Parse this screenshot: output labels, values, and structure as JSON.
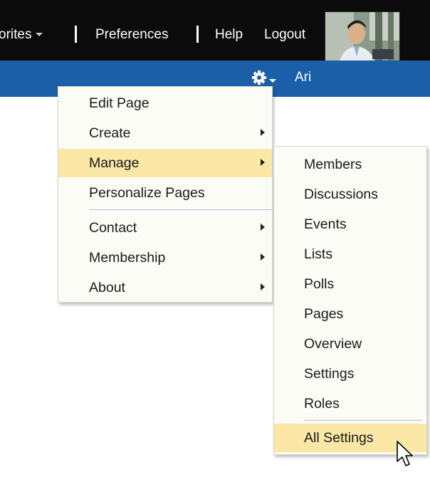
{
  "topbar": {
    "favorites_label": "orites",
    "preferences_label": "Preferences",
    "help_label": "Help",
    "logout_label": "Logout"
  },
  "subbar": {
    "user_name": "Ari"
  },
  "main_menu": {
    "items": [
      {
        "label": "Edit Page",
        "has_submenu": false,
        "highlighted": false
      },
      {
        "label": "Create",
        "has_submenu": true,
        "highlighted": false
      },
      {
        "label": "Manage",
        "has_submenu": true,
        "highlighted": true
      },
      {
        "label": "Personalize Pages",
        "has_submenu": false,
        "highlighted": false
      },
      {
        "label": "Contact",
        "has_submenu": true,
        "highlighted": false
      },
      {
        "label": "Membership",
        "has_submenu": true,
        "highlighted": false
      },
      {
        "label": "About",
        "has_submenu": true,
        "highlighted": false
      }
    ]
  },
  "manage_submenu": {
    "items": [
      {
        "label": "Members"
      },
      {
        "label": "Discussions"
      },
      {
        "label": "Events"
      },
      {
        "label": "Lists"
      },
      {
        "label": "Polls"
      },
      {
        "label": "Pages"
      },
      {
        "label": "Overview"
      },
      {
        "label": "Settings"
      },
      {
        "label": "Roles"
      },
      {
        "label": "All Settings",
        "highlighted": true
      }
    ]
  },
  "colors": {
    "topbar_bg": "#0b0b0b",
    "subbar_bg": "#1b5fa8",
    "menu_bg": "#fbfcf6",
    "highlight_bg": "#fbe7a6",
    "separator": "#a9bfdf"
  },
  "icons": {
    "favorites_caret": "chevron-down-icon",
    "settings": "gear-icon",
    "submenu": "chevron-right-icon",
    "pointer": "mouse-pointer-icon"
  }
}
